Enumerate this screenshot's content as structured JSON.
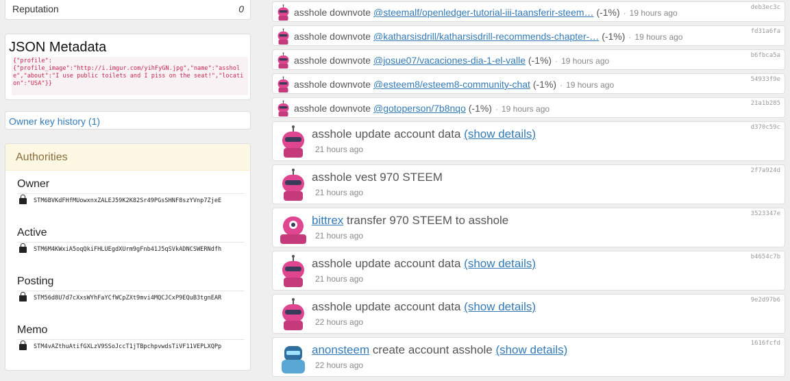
{
  "reputation": {
    "label": "Reputation",
    "value": "0"
  },
  "json_metadata": {
    "title": "JSON Metadata",
    "content": "{\"profile\":\n{\"profile_image\":\"http://i.imgur.com/yihFyGN.jpg\",\"name\":\"asshole\",\"about\":\"I use public toilets and I piss on the seat!\",\"location\":\"USA\"}}"
  },
  "owner_key_history": {
    "label": "Owner key history (1)"
  },
  "authorities": {
    "title": "Authorities",
    "keys": [
      {
        "role": "Owner",
        "key": "STM6BVKdFHfMUowxnxZALEJ59K2K82Sr49PGsSHNF8szYVnp7ZjeE"
      },
      {
        "role": "Active",
        "key": "STM6M4KWxiA5oqQkiFHLUEgdXUrm9gFnb41J5qSVkADNCSWERNdfh"
      },
      {
        "role": "Posting",
        "key": "STM56d8U7d7cXxsWYhFaYCfWCpZXt9mvi4MQCJCxP9EQuB3tgnEAR"
      },
      {
        "role": "Memo",
        "key": "STM4vAZthuAtifGXLzV9SSoJccT1jTBpchpvwdsTiVF11VEPLXQPp"
      }
    ]
  },
  "feed": [
    {
      "actor": "asshole",
      "action": "downvote",
      "link": "@steemalf/openledger-tutorial-iii-taansferir-steem…",
      "pct": "(-1%)",
      "time": "19 hours ago",
      "hash": "deb3ec3c",
      "avatar": "robot-pink"
    },
    {
      "actor": "asshole",
      "action": "downvote",
      "link": "@katharsisdrill/katharsisdrill-recommends-chapter-…",
      "pct": "(-1%)",
      "time": "19 hours ago",
      "hash": "fd31a6fa",
      "avatar": "robot-pink"
    },
    {
      "actor": "asshole",
      "action": "downvote",
      "link": "@josue07/vacaciones-dia-1-el-valle",
      "pct": "(-1%)",
      "time": "19 hours ago",
      "hash": "b6fbca5a",
      "avatar": "robot-pink"
    },
    {
      "actor": "asshole",
      "action": "downvote",
      "link": "@esteem8/esteem8-community-chat",
      "pct": "(-1%)",
      "time": "19 hours ago",
      "hash": "54933f9e",
      "avatar": "robot-pink"
    },
    {
      "actor": "asshole",
      "action": "downvote",
      "link": "@gotoperson/7b8nqo",
      "pct": "(-1%)",
      "time": "19 hours ago",
      "hash": "21a1b285",
      "avatar": "robot-pink"
    },
    {
      "actor": "asshole",
      "action": "update account data",
      "details": "(show details)",
      "time": "21 hours ago",
      "hash": "d370c59c",
      "avatar": "robot-pink"
    },
    {
      "actor": "asshole",
      "action": "vest 970 STEEM",
      "time": "21 hours ago",
      "hash": "2f7a924d",
      "avatar": "robot-pink"
    },
    {
      "actor": "bittrex",
      "action": "transfer 970 STEEM to asshole",
      "time": "21 hours ago",
      "hash": "3523347e",
      "avatar": "robot-pink-cyclops"
    },
    {
      "actor": "asshole",
      "action": "update account data",
      "details": "(show details)",
      "time": "21 hours ago",
      "hash": "b4654c7b",
      "avatar": "robot-pink"
    },
    {
      "actor": "asshole",
      "action": "update account data",
      "details": "(show details)",
      "time": "22 hours ago",
      "hash": "9e2d97b6",
      "avatar": "robot-pink"
    },
    {
      "actor": "anonsteem",
      "action": "create account asshole",
      "details": "(show details)",
      "time": "22 hours ago",
      "hash": "1616fcfd",
      "avatar": "robot-blue"
    }
  ],
  "colors": {
    "link": "#337ab7",
    "panel_warning_bg": "#fcf8e3",
    "code_bg": "#f9f2f4",
    "code_text": "#c7254e"
  }
}
